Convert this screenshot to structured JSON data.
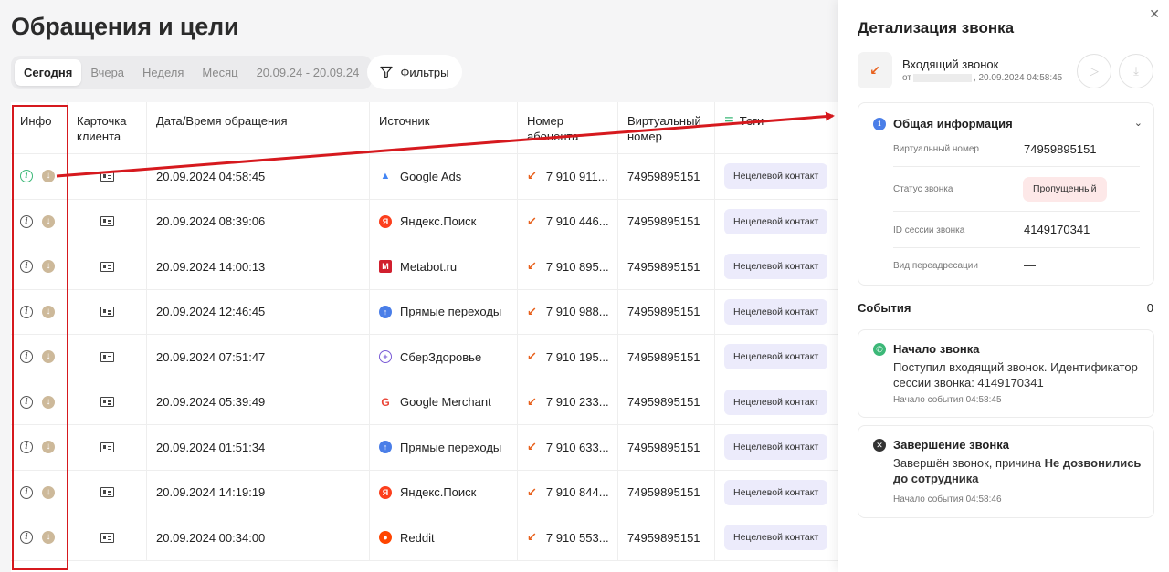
{
  "page_title": "Обращения и цели",
  "periods": [
    "Сегодня",
    "Вчера",
    "Неделя",
    "Месяц",
    "20.09.24 - 20.09.24"
  ],
  "filters_label": "Фильтры",
  "table": {
    "headers": {
      "info": "Инфо",
      "client_card": "Карточка клиента",
      "datetime": "Дата/Время обращения",
      "source": "Источник",
      "subscriber": "Номер абонента",
      "virtual": "Виртуальный номер",
      "tags": "Теги"
    },
    "rows": [
      {
        "datetime": "20.09.2024 04:58:45",
        "source": "Google Ads",
        "source_icon": "google-ads-icon",
        "source_color": "#4285f4",
        "phone": "7 910 911...",
        "virtual": "74959895151",
        "tag": "Нецелевой контакт",
        "highlight": true
      },
      {
        "datetime": "20.09.2024 08:39:06",
        "source": "Яндекс.Поиск",
        "source_icon": "yandex-icon",
        "source_color": "#fc3f1d",
        "phone": "7 910 446...",
        "virtual": "74959895151",
        "tag": "Нецелевой контакт"
      },
      {
        "datetime": "20.09.2024 14:00:13",
        "source": "Metabot.ru",
        "source_icon": "metabot-icon",
        "source_color": "#d11f2e",
        "phone": "7 910 895...",
        "virtual": "74959895151",
        "tag": "Нецелевой контакт"
      },
      {
        "datetime": "20.09.2024 12:46:45",
        "source": "Прямые переходы",
        "source_icon": "direct-arrow-icon",
        "source_color": "#4a7ee8",
        "phone": "7 910 988...",
        "virtual": "74959895151",
        "tag": "Нецелевой контакт"
      },
      {
        "datetime": "20.09.2024 07:51:47",
        "source": "СберЗдоровье",
        "source_icon": "sberzdorovie-icon",
        "source_color": "#7b5cd6",
        "phone": "7 910 195...",
        "virtual": "74959895151",
        "tag": "Нецелевой контакт"
      },
      {
        "datetime": "20.09.2024 05:39:49",
        "source": "Google Merchant",
        "source_icon": "google-icon",
        "source_color": "#ea4335",
        "phone": "7 910 233...",
        "virtual": "74959895151",
        "tag": "Нецелевой контакт"
      },
      {
        "datetime": "20.09.2024 01:51:34",
        "source": "Прямые переходы",
        "source_icon": "direct-arrow-icon",
        "source_color": "#4a7ee8",
        "phone": "7 910 633...",
        "virtual": "74959895151",
        "tag": "Нецелевой контакт"
      },
      {
        "datetime": "20.09.2024 14:19:19",
        "source": "Яндекс.Поиск",
        "source_icon": "yandex-icon",
        "source_color": "#fc3f1d",
        "phone": "7 910 844...",
        "virtual": "74959895151",
        "tag": "Нецелевой контакт"
      },
      {
        "datetime": "20.09.2024 00:34:00",
        "source": "Reddit",
        "source_icon": "reddit-icon",
        "source_color": "#ff4500",
        "phone": "7 910 553...",
        "virtual": "74959895151",
        "tag": "Нецелевой контакт"
      }
    ]
  },
  "panel": {
    "title": "Детализация звонка",
    "call_type": "Входящий звонок",
    "call_from_prefix": "от",
    "call_from_suffix": ", 20.09.2024 04:58:45",
    "general": {
      "title": "Общая информация",
      "virtual_label": "Виртуальный номер",
      "virtual_value": "74959895151",
      "status_label": "Статус звонка",
      "status_value": "Пропущенный",
      "session_label": "ID сессии звонка",
      "session_value": "4149170341",
      "redirect_label": "Вид переадресации",
      "redirect_value": "—"
    },
    "events_title": "События",
    "events_count": "0",
    "events": [
      {
        "title": "Начало звонка",
        "text": "Поступил входящий звонок. Идентификатор сессии звонка: 4149170341",
        "meta_label": "Начало события",
        "meta_time": "04:58:45"
      },
      {
        "title": "Завершение звонка",
        "text_plain": "Завершён звонок, причина ",
        "text_bold": "Не дозвонились до сотрудника",
        "meta_label": "Начало события",
        "meta_time": "04:58:46"
      }
    ]
  },
  "colors": {
    "accent_red": "#d6191e",
    "incoming_arrow": "#e8601c",
    "tag_bg": "#ecebfb",
    "status_bg": "#fde8e8"
  }
}
